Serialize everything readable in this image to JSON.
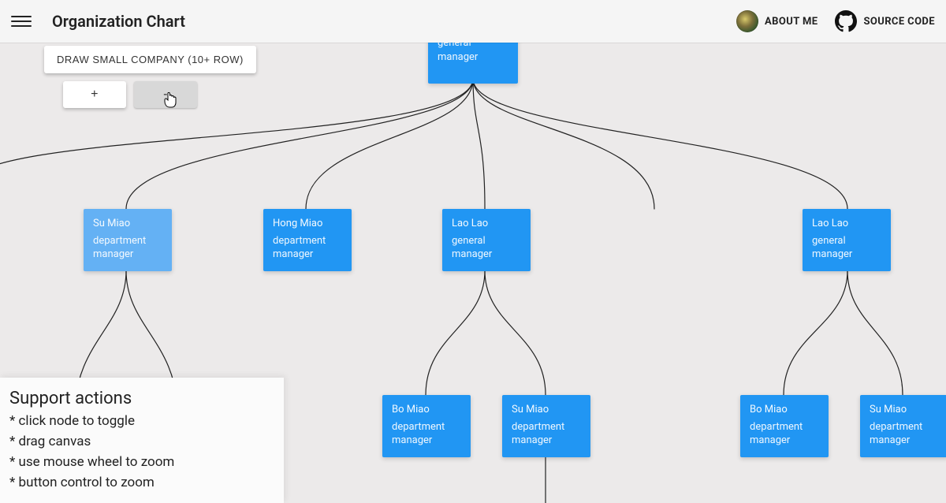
{
  "app": {
    "title": "Organization Chart"
  },
  "header": {
    "about_label": "ABOUT ME",
    "source_label": "SOURCE CODE"
  },
  "toolbar": {
    "draw_label": "DRAW SMALL COMPANY (10+ ROW)",
    "zoom_in": "+",
    "zoom_out": "-"
  },
  "panel": {
    "heading": "Support actions",
    "lines": [
      "* click node to toggle",
      "* drag canvas",
      "* use mouse wheel to zoom",
      "* button control to zoom"
    ]
  },
  "chart_data": {
    "type": "tree",
    "root": {
      "id": "n0",
      "name": "",
      "title": "general manager",
      "children": [
        {
          "id": "n1",
          "name": "Su Miao",
          "title": "department manager",
          "highlight": true,
          "children": [
            {
              "id": "n1a",
              "name": "",
              "title": ""
            },
            {
              "id": "n1b",
              "name": "",
              "title": ""
            }
          ]
        },
        {
          "id": "n2",
          "name": "Hong Miao",
          "title": "department manager",
          "children": []
        },
        {
          "id": "n3",
          "name": "Lao Lao",
          "title": "general manager",
          "children": [
            {
              "id": "n3a",
              "name": "Bo Miao",
              "title": "department manager",
              "children": []
            },
            {
              "id": "n3b",
              "name": "Su Miao",
              "title": "department manager",
              "children": [
                {
                  "id": "n3b1",
                  "name": "",
                  "title": ""
                }
              ]
            }
          ]
        },
        {
          "id": "n4",
          "name": "",
          "title": "",
          "offscreen": true,
          "children": []
        },
        {
          "id": "n5",
          "name": "Lao Lao",
          "title": "general manager",
          "children": [
            {
              "id": "n5a",
              "name": "Bo Miao",
              "title": "department manager",
              "children": []
            },
            {
              "id": "n5b",
              "name": "Su Miao",
              "title": "department manager",
              "children": []
            }
          ]
        }
      ]
    }
  },
  "nodes": {
    "n0": {
      "title_key": "chart_data.root.title"
    },
    "n1": {
      "name": "Su Miao",
      "title": "department manager"
    },
    "n2": {
      "name": "Hong Miao",
      "title": "department manager"
    },
    "n3": {
      "name": "Lao Lao",
      "title": "general manager"
    },
    "n5": {
      "name": "Lao Lao",
      "title": "general manager"
    },
    "n3a": {
      "name": "Bo Miao",
      "title": "department manager"
    },
    "n3b": {
      "name": "Su Miao",
      "title": "department manager"
    },
    "n5a": {
      "name": "Bo Miao",
      "title": "department manager"
    },
    "n5b": {
      "name": "Su Miao",
      "title": "department manager"
    }
  }
}
